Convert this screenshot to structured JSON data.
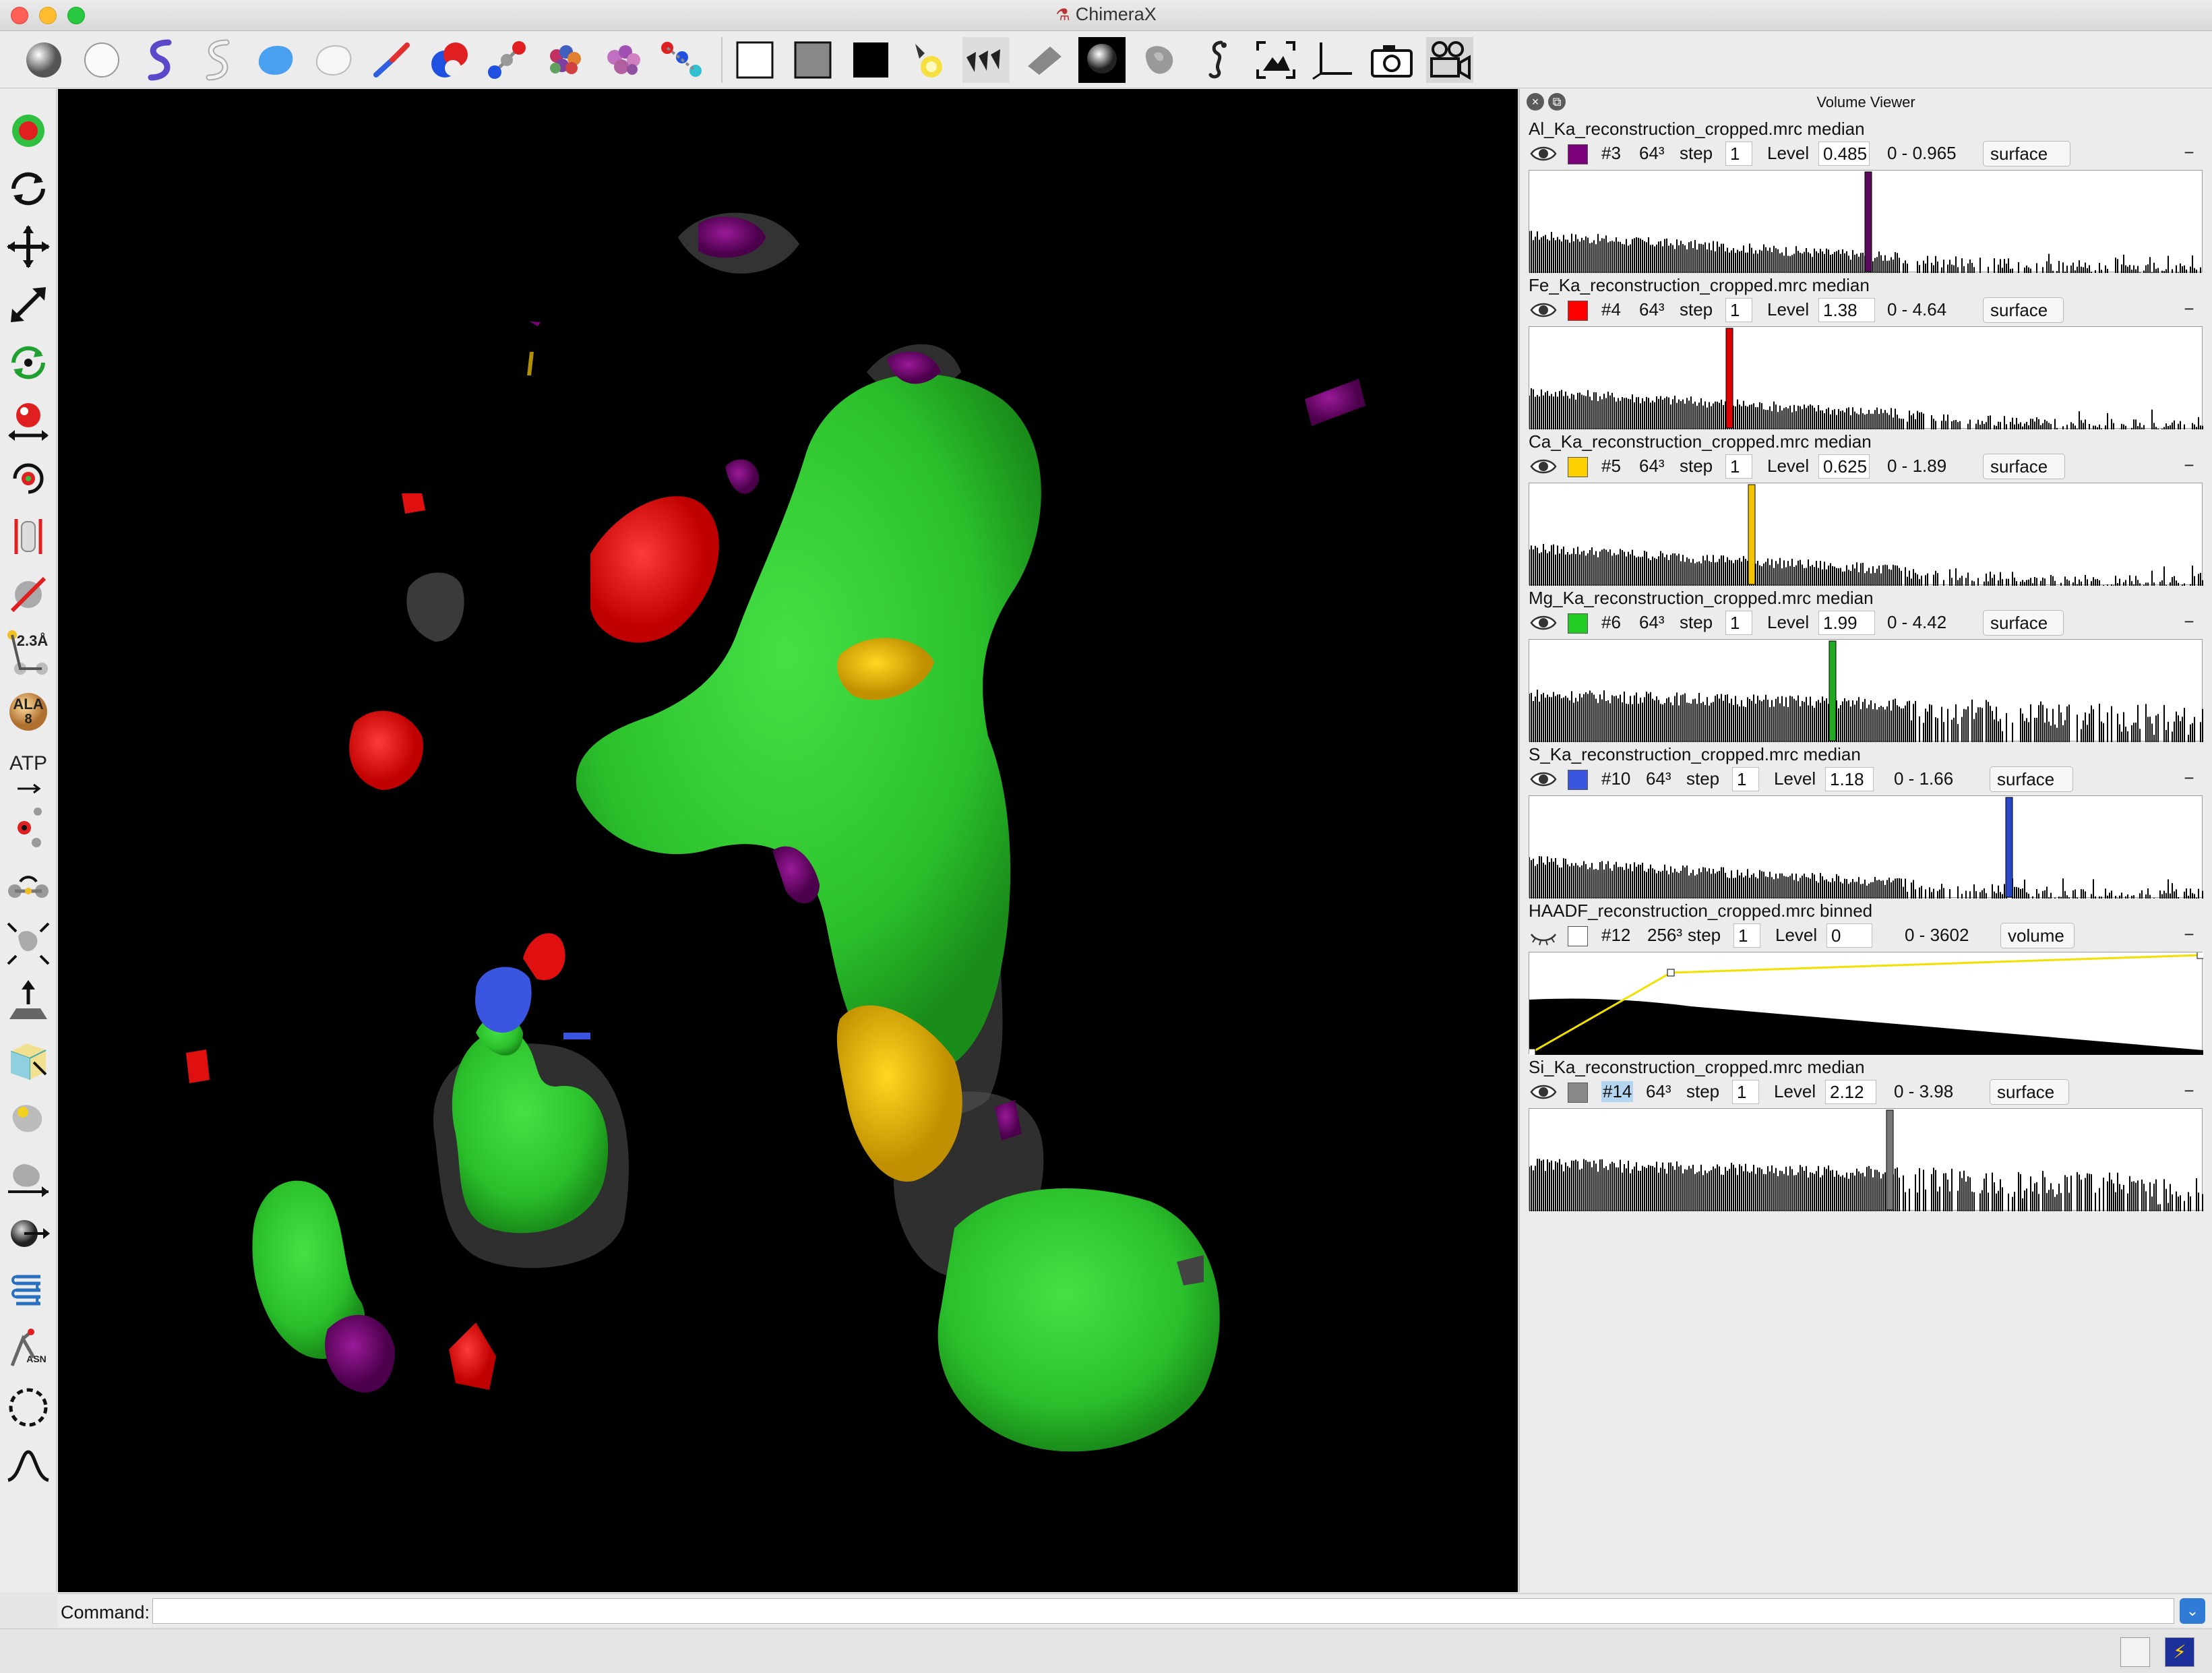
{
  "window": {
    "title": "ChimeraX"
  },
  "toolbar": {
    "icons": [
      "ball-style-icon",
      "sphere-style-icon",
      "cartoon-icon",
      "cartoon-outline-icon",
      "surface-icon",
      "surface-outline-icon",
      "stick-icon",
      "sphere-atoms-icon",
      "ball-stick-icon",
      "atoms-cluster-icon",
      "atoms-cluster-pink-icon",
      "ball-chain-icon",
      "white-background-icon",
      "gray-background-icon",
      "black-background-icon",
      "simple-lighting-icon",
      "soft-lighting-icon",
      "flat-lighting-icon",
      "full-lighting-icon",
      "shadows-icon",
      "silhouette-icon",
      "seahorse-icon",
      "view-all-icon",
      "axes-icon",
      "camera-icon",
      "movie-camera-icon"
    ]
  },
  "left_tools": {
    "icons": [
      "select-icon",
      "rotate-icon",
      "translate-icon",
      "zoom-icon",
      "rotate-and-select-icon",
      "pivot-icon",
      "move-atoms-icon",
      "distance-icon",
      "clip-icon",
      "label-icon",
      "bond-rotation-icon",
      "swap-aa-icon",
      "ligand-icon",
      "tape-icon",
      "map-zoom-icon",
      "contour-level-icon",
      "crop-icon",
      "map-move-icon",
      "pick-blob-icon",
      "map-eraser-icon",
      "play-coordinates-icon",
      "tug-icon",
      "swapna-icon",
      "lasso-icon",
      "curve-icon"
    ],
    "distance_label": "2.3Å",
    "ala_label": "ALA",
    "ala_number": "8",
    "atp_label": "ATP",
    "asn_label": "ASN"
  },
  "command": {
    "label": "Command:",
    "value": ""
  },
  "volume_viewer": {
    "title": "Volume Viewer",
    "volumes": [
      {
        "name": "Al_Ka_reconstruction_cropped.mrc median",
        "shown": true,
        "color": "#7b007b",
        "id": "#3",
        "size": "64³",
        "step_label": "step",
        "step": "1",
        "level_label": "Level",
        "level": "0.485",
        "range": "0 - 0.965",
        "style": "surface",
        "marker_fraction": 0.503,
        "marker_color": "#5a0a5a"
      },
      {
        "name": "Fe_Ka_reconstruction_cropped.mrc median",
        "shown": true,
        "color": "#ff0000",
        "id": "#4",
        "size": "64³",
        "step_label": "step",
        "step": "1",
        "level_label": "Level",
        "level": "1.38",
        "range": "0 - 4.64",
        "style": "surface",
        "marker_fraction": 0.297,
        "marker_color": "#dd0000"
      },
      {
        "name": "Ca_Ka_reconstruction_cropped.mrc median",
        "shown": true,
        "color": "#ffd000",
        "id": "#5",
        "size": "64³",
        "step_label": "step",
        "step": "1",
        "level_label": "Level",
        "level": "0.625",
        "range": "0 - 1.89",
        "style": "surface",
        "marker_fraction": 0.33,
        "marker_color": "#f4c400"
      },
      {
        "name": "Mg_Ka_reconstruction_cropped.mrc median",
        "shown": true,
        "color": "#22cc22",
        "id": "#6",
        "size": "64³",
        "step_label": "step",
        "step": "1",
        "level_label": "Level",
        "level": "1.99",
        "range": "0 - 4.42",
        "style": "surface",
        "marker_fraction": 0.45,
        "marker_color": "#22aa22"
      },
      {
        "name": "S_Ka_reconstruction_cropped.mrc median",
        "shown": true,
        "color": "#3a55e0",
        "id": "#10",
        "size": "64³",
        "step_label": "step",
        "step": "1",
        "level_label": "Level",
        "level": "1.18",
        "range": "0 - 1.66",
        "style": "surface",
        "marker_fraction": 0.712,
        "marker_color": "#2846c8"
      },
      {
        "name": "HAADF_reconstruction_cropped.mrc binned",
        "shown": false,
        "color": "#ffffff",
        "id": "#12",
        "size": "256³",
        "step_label": "step",
        "step": "1",
        "level_label": "Level",
        "level": "0",
        "range": "0 - 3602",
        "style": "volume",
        "marker_fraction": null,
        "marker_color": "#f2e000"
      },
      {
        "name": "Si_Ka_reconstruction_cropped.mrc median",
        "shown": true,
        "color": "#888888",
        "id": "#14",
        "size": "64³",
        "step_label": "step",
        "step": "1",
        "level_label": "Level",
        "level": "2.12",
        "range": "0 - 3.98",
        "style": "surface",
        "marker_fraction": 0.535,
        "marker_color": "#777777",
        "id_selected": true
      }
    ]
  }
}
